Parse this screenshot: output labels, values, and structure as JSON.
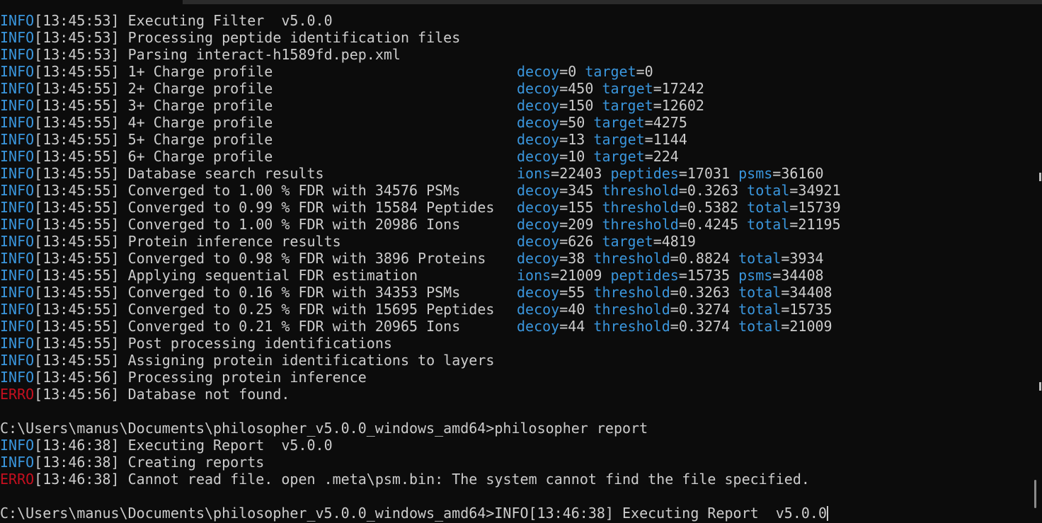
{
  "lines": [
    {
      "level": "INFO",
      "time": "[13:45:53]",
      "message": "Executing Filter  v5.0.0",
      "fields": []
    },
    {
      "level": "INFO",
      "time": "[13:45:53]",
      "message": "Processing peptide identification files",
      "fields": []
    },
    {
      "level": "INFO",
      "time": "[13:45:53]",
      "message": "Parsing interact-h1589fd.pep.xml",
      "fields": []
    },
    {
      "level": "INFO",
      "time": "[13:45:55]",
      "message": "1+ Charge profile",
      "fields": [
        {
          "key": "decoy",
          "value": "0"
        },
        {
          "key": "target",
          "value": "0"
        }
      ]
    },
    {
      "level": "INFO",
      "time": "[13:45:55]",
      "message": "2+ Charge profile",
      "fields": [
        {
          "key": "decoy",
          "value": "450"
        },
        {
          "key": "target",
          "value": "17242"
        }
      ]
    },
    {
      "level": "INFO",
      "time": "[13:45:55]",
      "message": "3+ Charge profile",
      "fields": [
        {
          "key": "decoy",
          "value": "150"
        },
        {
          "key": "target",
          "value": "12602"
        }
      ]
    },
    {
      "level": "INFO",
      "time": "[13:45:55]",
      "message": "4+ Charge profile",
      "fields": [
        {
          "key": "decoy",
          "value": "50"
        },
        {
          "key": "target",
          "value": "4275"
        }
      ]
    },
    {
      "level": "INFO",
      "time": "[13:45:55]",
      "message": "5+ Charge profile",
      "fields": [
        {
          "key": "decoy",
          "value": "13"
        },
        {
          "key": "target",
          "value": "1144"
        }
      ]
    },
    {
      "level": "INFO",
      "time": "[13:45:55]",
      "message": "6+ Charge profile",
      "fields": [
        {
          "key": "decoy",
          "value": "10"
        },
        {
          "key": "target",
          "value": "224"
        }
      ]
    },
    {
      "level": "INFO",
      "time": "[13:45:55]",
      "message": "Database search results",
      "fields": [
        {
          "key": "ions",
          "value": "22403"
        },
        {
          "key": "peptides",
          "value": "17031"
        },
        {
          "key": "psms",
          "value": "36160"
        }
      ]
    },
    {
      "level": "INFO",
      "time": "[13:45:55]",
      "message": "Converged to 1.00 % FDR with 34576 PSMs",
      "fields": [
        {
          "key": "decoy",
          "value": "345"
        },
        {
          "key": "threshold",
          "value": "0.3263"
        },
        {
          "key": "total",
          "value": "34921"
        }
      ]
    },
    {
      "level": "INFO",
      "time": "[13:45:55]",
      "message": "Converged to 0.99 % FDR with 15584 Peptides",
      "fields": [
        {
          "key": "decoy",
          "value": "155"
        },
        {
          "key": "threshold",
          "value": "0.5382"
        },
        {
          "key": "total",
          "value": "15739"
        }
      ]
    },
    {
      "level": "INFO",
      "time": "[13:45:55]",
      "message": "Converged to 1.00 % FDR with 20986 Ions",
      "fields": [
        {
          "key": "decoy",
          "value": "209"
        },
        {
          "key": "threshold",
          "value": "0.4245"
        },
        {
          "key": "total",
          "value": "21195"
        }
      ]
    },
    {
      "level": "INFO",
      "time": "[13:45:55]",
      "message": "Protein inference results",
      "fields": [
        {
          "key": "decoy",
          "value": "626"
        },
        {
          "key": "target",
          "value": "4819"
        }
      ]
    },
    {
      "level": "INFO",
      "time": "[13:45:55]",
      "message": "Converged to 0.98 % FDR with 3896 Proteins",
      "fields": [
        {
          "key": "decoy",
          "value": "38"
        },
        {
          "key": "threshold",
          "value": "0.8824"
        },
        {
          "key": "total",
          "value": "3934"
        }
      ]
    },
    {
      "level": "INFO",
      "time": "[13:45:55]",
      "message": "Applying sequential FDR estimation",
      "fields": [
        {
          "key": "ions",
          "value": "21009"
        },
        {
          "key": "peptides",
          "value": "15735"
        },
        {
          "key": "psms",
          "value": "34408"
        }
      ]
    },
    {
      "level": "INFO",
      "time": "[13:45:55]",
      "message": "Converged to 0.16 % FDR with 34353 PSMs",
      "fields": [
        {
          "key": "decoy",
          "value": "55"
        },
        {
          "key": "threshold",
          "value": "0.3263"
        },
        {
          "key": "total",
          "value": "34408"
        }
      ]
    },
    {
      "level": "INFO",
      "time": "[13:45:55]",
      "message": "Converged to 0.25 % FDR with 15695 Peptides",
      "fields": [
        {
          "key": "decoy",
          "value": "40"
        },
        {
          "key": "threshold",
          "value": "0.3274"
        },
        {
          "key": "total",
          "value": "15735"
        }
      ]
    },
    {
      "level": "INFO",
      "time": "[13:45:55]",
      "message": "Converged to 0.21 % FDR with 20965 Ions",
      "fields": [
        {
          "key": "decoy",
          "value": "44"
        },
        {
          "key": "threshold",
          "value": "0.3274"
        },
        {
          "key": "total",
          "value": "21009"
        }
      ]
    },
    {
      "level": "INFO",
      "time": "[13:45:55]",
      "message": "Post processing identifications",
      "fields": []
    },
    {
      "level": "INFO",
      "time": "[13:45:55]",
      "message": "Assigning protein identifications to layers",
      "fields": []
    },
    {
      "level": "INFO",
      "time": "[13:45:56]",
      "message": "Processing protein inference",
      "fields": []
    },
    {
      "level": "ERRO",
      "time": "[13:45:56]",
      "message": "Database not found.",
      "fields": []
    },
    {
      "text": ""
    },
    {
      "text": "C:\\Users\\manus\\Documents\\philosopher_v5.0.0_windows_amd64>philosopher report"
    },
    {
      "level": "INFO",
      "time": "[13:46:38]",
      "message": "Executing Report  v5.0.0",
      "fields": []
    },
    {
      "level": "INFO",
      "time": "[13:46:38]",
      "message": "Creating reports",
      "fields": []
    },
    {
      "level": "ERRO",
      "time": "[13:46:38]",
      "message": "Cannot read file. open .meta\\psm.bin: The system cannot find the file specified.",
      "fields": []
    },
    {
      "text": ""
    },
    {
      "text": "C:\\Users\\manus\\Documents\\philosopher_v5.0.0_windows_amd64>INFO[13:46:38] Executing Report  v5.0.0",
      "cursor": true
    }
  ],
  "colors": {
    "background": "#0c0c0c",
    "foreground": "#cccccc",
    "info": "#3a96dd",
    "error": "#c50f1f"
  }
}
